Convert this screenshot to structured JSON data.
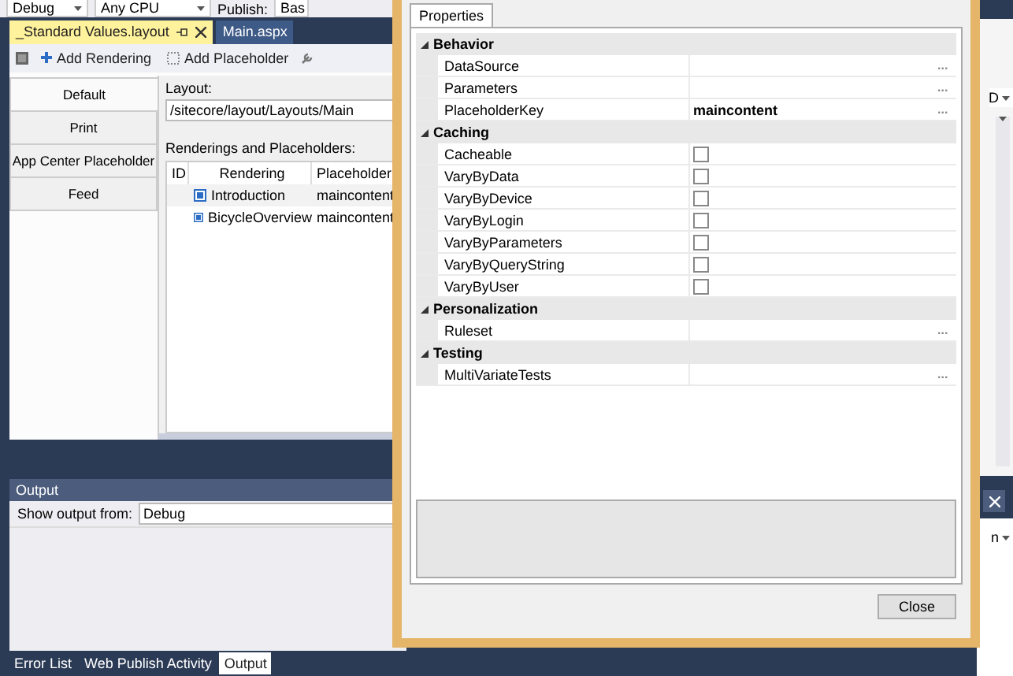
{
  "toolbar": {
    "configuration": "Debug",
    "platform": "Any CPU",
    "publish_label": "Publish:",
    "publish_value": "Bas"
  },
  "document_tabs": [
    {
      "label": "_Standard Values.layout",
      "selected": true
    },
    {
      "label": "Main.aspx",
      "selected": false
    }
  ],
  "designer_toolbar": {
    "add_rendering": "Add Rendering",
    "add_placeholder": "Add Placeholder"
  },
  "devices": [
    {
      "label": "Default",
      "selected": true
    },
    {
      "label": "Print",
      "selected": false
    },
    {
      "label": "App Center Placeholder",
      "selected": false
    },
    {
      "label": "Feed",
      "selected": false
    }
  ],
  "layout": {
    "label": "Layout:",
    "value": "/sitecore/layout/Layouts/Main"
  },
  "renderings": {
    "label": "Renderings and Placeholders:",
    "columns": [
      "ID",
      "Rendering",
      "Placeholder"
    ],
    "rows": [
      {
        "rendering": "Introduction",
        "placeholder": "maincontent",
        "selected": true
      },
      {
        "rendering": "BicycleOverview",
        "placeholder": "maincontent",
        "selected": false
      }
    ]
  },
  "output": {
    "title": "Output",
    "show_label": "Show output from:",
    "source": "Debug"
  },
  "bottom_tabs": [
    {
      "label": "Error List",
      "selected": false
    },
    {
      "label": "Web Publish Activity",
      "selected": false
    },
    {
      "label": "Output",
      "selected": true
    }
  ],
  "side_panel": {
    "field_1": "D",
    "field_2": "n"
  },
  "dialog": {
    "tabs": [
      {
        "label": "Properties",
        "selected": true
      }
    ],
    "categories": [
      {
        "name": "Behavior",
        "expanded": true,
        "properties": [
          {
            "name": "DataSource",
            "kind": "text",
            "button": "..."
          },
          {
            "name": "Parameters",
            "kind": "text",
            "button": "..."
          },
          {
            "name": "PlaceholderKey",
            "kind": "text",
            "value": "maincontent",
            "button": "..."
          }
        ]
      },
      {
        "name": "Caching",
        "expanded": true,
        "properties": [
          {
            "name": "Cacheable",
            "kind": "checkbox",
            "checked": false
          },
          {
            "name": "VaryByData",
            "kind": "checkbox",
            "checked": false
          },
          {
            "name": "VaryByDevice",
            "kind": "checkbox",
            "checked": false
          },
          {
            "name": "VaryByLogin",
            "kind": "checkbox",
            "checked": false
          },
          {
            "name": "VaryByParameters",
            "kind": "checkbox",
            "checked": false
          },
          {
            "name": "VaryByQueryString",
            "kind": "checkbox",
            "checked": false
          },
          {
            "name": "VaryByUser",
            "kind": "checkbox",
            "checked": false
          }
        ]
      },
      {
        "name": "Personalization",
        "expanded": true,
        "properties": [
          {
            "name": "Ruleset",
            "kind": "text",
            "button": "..."
          }
        ]
      },
      {
        "name": "Testing",
        "expanded": true,
        "properties": [
          {
            "name": "MultiVariateTests",
            "kind": "text",
            "button": "..."
          }
        ]
      }
    ],
    "close_button": "Close"
  }
}
